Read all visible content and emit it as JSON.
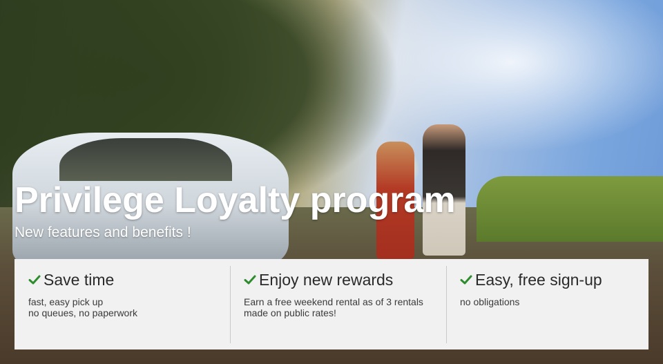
{
  "hero": {
    "title": "Privilege Loyalty program",
    "subtitle": "New features and benefits !"
  },
  "features": [
    {
      "icon": "checkmark-icon",
      "title": "Save time",
      "lines": [
        "fast, easy pick up",
        "no queues, no paperwork"
      ]
    },
    {
      "icon": "checkmark-icon",
      "title": "Enjoy new rewards",
      "lines": [
        "Earn a free weekend rental as of 3 rentals",
        "made on public rates!"
      ]
    },
    {
      "icon": "checkmark-icon",
      "title": "Easy, free sign-up",
      "lines": [
        "no obligations"
      ]
    }
  ],
  "colors": {
    "checkmark": "#2e8b2e",
    "panel_bg": "#f1f1f1",
    "hero_text": "#ffffff"
  }
}
